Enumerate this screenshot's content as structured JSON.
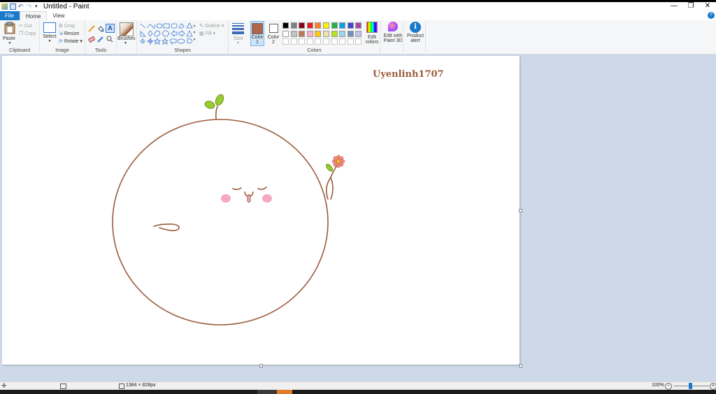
{
  "window": {
    "title": "Untitled - Paint",
    "controls": [
      "—",
      "❐",
      "✕"
    ]
  },
  "tabs": [
    "File",
    "Home",
    "View"
  ],
  "ribbon": {
    "clipboard": {
      "paste": "Paste",
      "cut": "Cut",
      "copy": "Copy",
      "label": "Clipboard"
    },
    "image": {
      "select": "Select",
      "crop": "Crop",
      "resize": "Resize",
      "rotate": "Rotate",
      "label": "Image"
    },
    "tools": {
      "label": "Tools"
    },
    "brushes": {
      "label": "Brushes"
    },
    "shapes": {
      "outline": "Outline",
      "fill": "Fill",
      "label": "Shapes"
    },
    "size": {
      "label": "Size"
    },
    "colors": {
      "color1_line1": "Color",
      "color1_line2": "1",
      "color2_line1": "Color",
      "color2_line2": "2",
      "label": "Colors",
      "color1": "#b0664a",
      "color2": "#ffffff",
      "palette_row1": [
        "#000000",
        "#7f7f7f",
        "#880015",
        "#ed1c24",
        "#ff7f27",
        "#fff200",
        "#22b14c",
        "#00a2e8",
        "#3f48cc",
        "#a349a4"
      ],
      "palette_row2": [
        "#ffffff",
        "#c3c3c3",
        "#b97a57",
        "#ffaec9",
        "#ffc90e",
        "#efe4b0",
        "#b5e61d",
        "#99d9ea",
        "#7092be",
        "#c8bfe7"
      ]
    },
    "edit_colors": {
      "line1": "Edit",
      "line2": "colors"
    },
    "edit_3d": {
      "line1": "Edit with",
      "line2": "Paint 3D"
    },
    "product_alert": {
      "line1": "Product",
      "line2": "alert"
    }
  },
  "canvas": {
    "watermark": "Uyenlinh1707",
    "stroke_color": "#9a5c3c",
    "leaf_color": "#9acd32",
    "blush_color": "#f7a8c4",
    "flower_petal_color": "#f28b82",
    "flower_center_color": "#f6b94a"
  },
  "status": {
    "dimensions": "1384 × 828px",
    "zoom": "100%"
  }
}
